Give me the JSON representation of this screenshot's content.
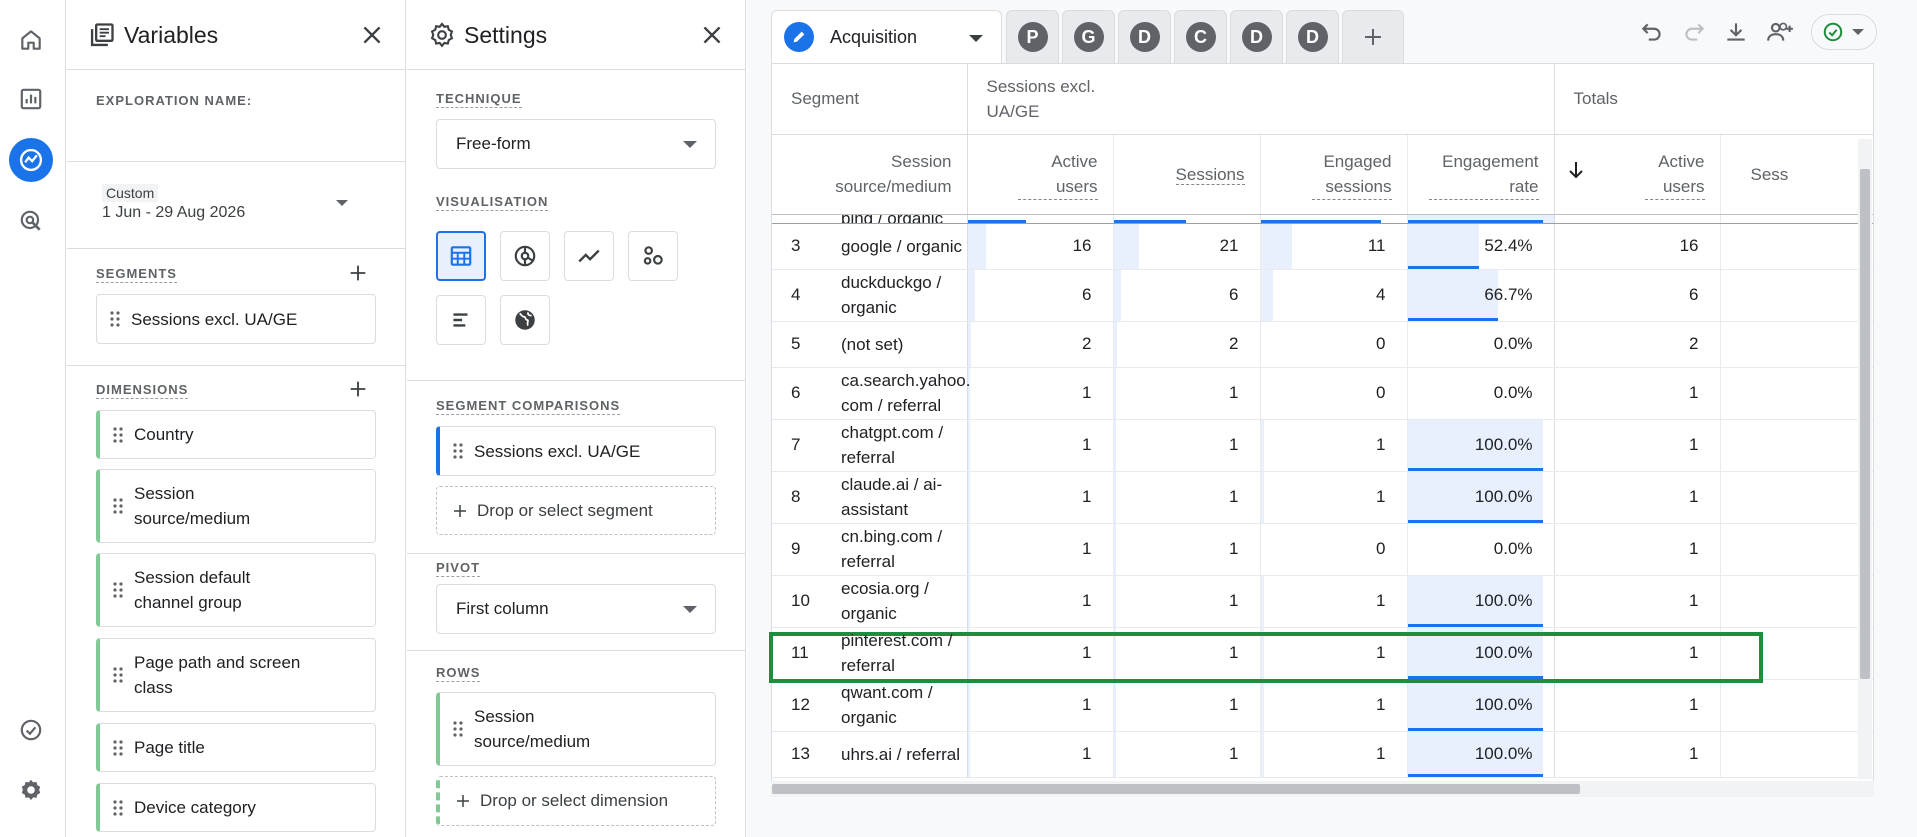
{
  "rail": {
    "icons": [
      "home-icon",
      "reports-icon",
      "explore-icon",
      "advertising-icon",
      "admin-checklist-icon",
      "settings-icon"
    ]
  },
  "variables": {
    "title": "Variables",
    "exploration_name_label": "EXPLORATION NAME:",
    "date": {
      "label": "Custom",
      "range": "1 Jun - 29 Aug 2026"
    },
    "segments_label": "SEGMENTS",
    "segments": [
      "Sessions excl. UA/GE"
    ],
    "dimensions_label": "DIMENSIONS",
    "dimensions": [
      "Country",
      "Session source/medium",
      "Session default channel group",
      "Page path and screen class",
      "Page title",
      "Device category"
    ]
  },
  "settings": {
    "title": "Settings",
    "technique_label": "TECHNIQUE",
    "technique_value": "Free-form",
    "visualisation_label": "VISUALISATION",
    "visualisations": [
      "table-icon",
      "donut-chart-icon",
      "line-chart-icon",
      "scatter-chart-icon",
      "bar-chart-icon",
      "geo-map-icon"
    ],
    "segment_comparisons_label": "SEGMENT COMPARISONS",
    "segment_comparison": "Sessions excl. UA/GE",
    "drop_segment": "Drop or select segment",
    "pivot_label": "PIVOT",
    "pivot_value": "First column",
    "rows_label": "ROWS",
    "row_dimension": "Session source/medium",
    "drop_dimension": "Drop or select dimension"
  },
  "tabs": {
    "active": "Acquisition",
    "others": [
      "P",
      "G",
      "D",
      "C",
      "D",
      "D"
    ],
    "add": "+"
  },
  "table": {
    "header_segment": "Segment",
    "segment_name": "Sessions excl. UA/GE",
    "header_totals": "Totals",
    "dim_header": "Session source/medium",
    "col_headers": [
      "Active users",
      "Sessions",
      "Engaged sessions",
      "Engagement rate"
    ],
    "totals_col": "Active users",
    "totals_col2": "Sess",
    "partial_row": {
      "dim": "bing / organic"
    },
    "rows": [
      {
        "idx": "3",
        "dim": "google / organic",
        "active": "16",
        "sessions": "21",
        "engaged": "11",
        "rate": "52.4%",
        "total": "16",
        "fracs": [
          0.12,
          0.17,
          0.21,
          0.524
        ]
      },
      {
        "idx": "4",
        "dim": "duckduckgo / organic",
        "active": "6",
        "sessions": "6",
        "engaged": "4",
        "rate": "66.7%",
        "total": "6",
        "fracs": [
          0.05,
          0.05,
          0.08,
          0.667
        ]
      },
      {
        "idx": "5",
        "dim": "(not set)",
        "active": "2",
        "sessions": "2",
        "engaged": "0",
        "rate": "0.0%",
        "total": "2",
        "fracs": [
          0.02,
          0.02,
          0,
          0
        ]
      },
      {
        "idx": "6",
        "dim": "ca.search.yahoo. com / referral",
        "active": "1",
        "sessions": "1",
        "engaged": "0",
        "rate": "0.0%",
        "total": "1",
        "fracs": [
          0.01,
          0.01,
          0,
          0
        ]
      },
      {
        "idx": "7",
        "dim": "chatgpt.com / referral",
        "active": "1",
        "sessions": "1",
        "engaged": "1",
        "rate": "100.0%",
        "total": "1",
        "fracs": [
          0.01,
          0.01,
          0.02,
          1
        ]
      },
      {
        "idx": "8",
        "dim": "claude.ai / ai-assistant",
        "active": "1",
        "sessions": "1",
        "engaged": "1",
        "rate": "100.0%",
        "total": "1",
        "fracs": [
          0.01,
          0.01,
          0.02,
          1
        ]
      },
      {
        "idx": "9",
        "dim": "cn.bing.com / referral",
        "active": "1",
        "sessions": "1",
        "engaged": "0",
        "rate": "0.0%",
        "total": "1",
        "fracs": [
          0.01,
          0.01,
          0,
          0
        ]
      },
      {
        "idx": "10",
        "dim": "ecosia.org / organic",
        "active": "1",
        "sessions": "1",
        "engaged": "1",
        "rate": "100.0%",
        "total": "1",
        "fracs": [
          0.01,
          0.01,
          0.02,
          1
        ]
      },
      {
        "idx": "11",
        "dim": "pinterest.com / referral",
        "active": "1",
        "sessions": "1",
        "engaged": "1",
        "rate": "100.0%",
        "total": "1",
        "fracs": [
          0.01,
          0.01,
          0.02,
          1
        ]
      },
      {
        "idx": "12",
        "dim": "qwant.com / organic",
        "active": "1",
        "sessions": "1",
        "engaged": "1",
        "rate": "100.0%",
        "total": "1",
        "fracs": [
          0.01,
          0.01,
          0.02,
          1
        ]
      },
      {
        "idx": "13",
        "dim": "uhrs.ai / referral",
        "active": "1",
        "sessions": "1",
        "engaged": "1",
        "rate": "100.0%",
        "total": "1",
        "fracs": [
          0.01,
          0.01,
          0.02,
          1
        ]
      }
    ]
  },
  "colors": {
    "accent": "#1a73e8",
    "bar_fill": "#e8f0fe",
    "highlight": "#1e8e3e",
    "status_ok": "#1e8e3e"
  }
}
